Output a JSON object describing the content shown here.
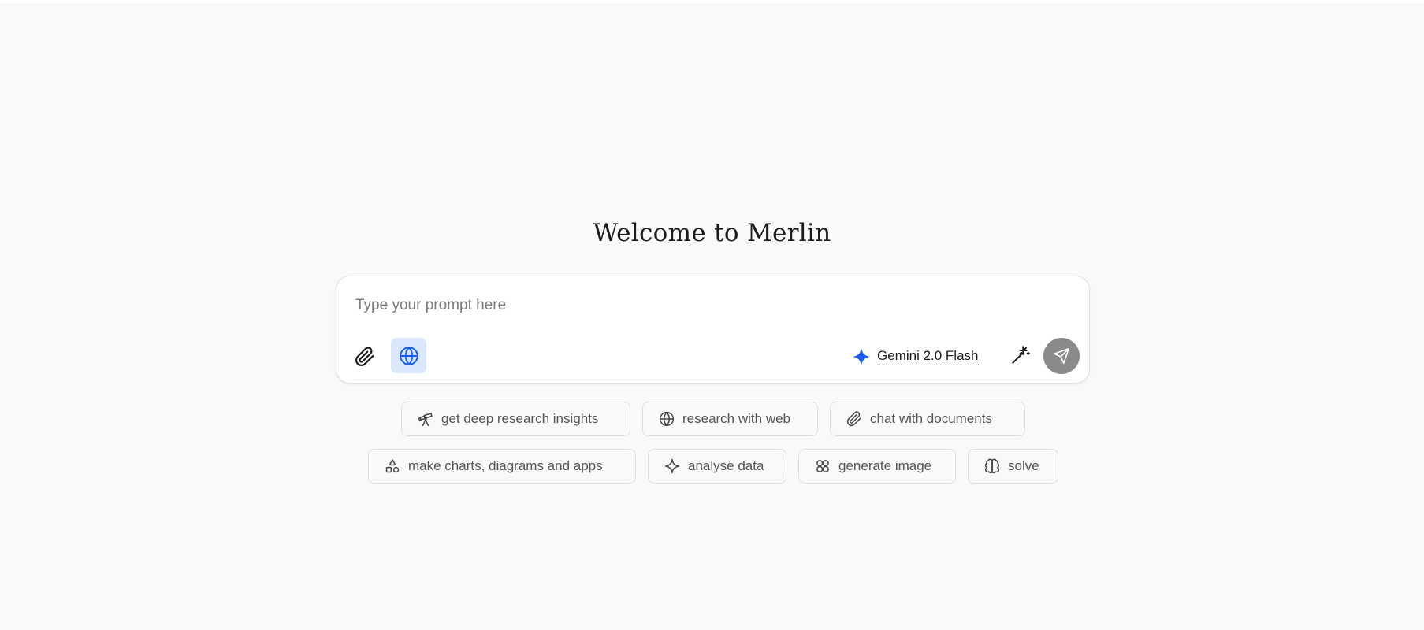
{
  "welcome": {
    "title": "Welcome to Merlin"
  },
  "composer": {
    "placeholder": "Type your prompt here",
    "attach_icon": "paperclip-icon",
    "web_icon": "globe-icon",
    "model_icon": "sparkle-icon",
    "model_label": "Gemini 2.0 Flash",
    "magic_icon": "magic-wand-icon",
    "send_icon": "send-icon"
  },
  "suggestions": {
    "row1": [
      {
        "label": "get deep research insights",
        "icon": "telescope-icon"
      },
      {
        "label": "research with web",
        "icon": "globe-icon"
      },
      {
        "label": "chat with documents",
        "icon": "paperclip-icon"
      }
    ],
    "row2": [
      {
        "label": "make charts, diagrams and apps",
        "icon": "shapes-icon"
      },
      {
        "label": "analyse data",
        "icon": "sparkle-icon"
      },
      {
        "label": "generate image",
        "icon": "image-gen-icon"
      },
      {
        "label": "solve",
        "icon": "brain-icon"
      }
    ]
  },
  "colors": {
    "background": "#f9f9f9",
    "accent_blue": "#1a5cf0",
    "web_toggle_bg": "#dbe8fb",
    "send_bg": "#8a8a8a"
  }
}
